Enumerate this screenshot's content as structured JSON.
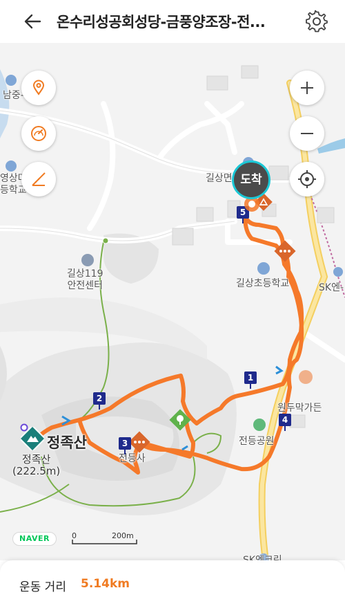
{
  "header": {
    "title": "온수리성공회성당-금풍양조장-전..."
  },
  "map": {
    "labels": {
      "school_top": "길상초등학교",
      "school_partial_top": "남중-",
      "school_left": "영상마\n등학교",
      "fire_station": "길상119\n안전센터",
      "gilsang_top": "길상면",
      "gilsang_school": "길상초등학교",
      "sk": "SK엔-",
      "peak_name": "정족산",
      "peak_label": "정족산\n(222.5m)",
      "temple": "전등사",
      "park": "전등공원",
      "restaurant": "원두막가든",
      "bottom_station": "SK엔크린"
    },
    "arrival_label": "도착",
    "waypoints": [
      "1",
      "2",
      "3",
      "4",
      "5"
    ],
    "route_color": "#f5792a",
    "scale": {
      "zero": "0",
      "distance": "200m"
    },
    "brand": "NAVER"
  },
  "controls": {
    "left": [
      "location-pin-icon",
      "speedometer-icon",
      "elevation-icon"
    ],
    "right": [
      "zoom-in-icon",
      "zoom-out-icon",
      "crosshair-icon"
    ]
  },
  "stats": {
    "distance_label": "운동 거리",
    "distance_value": "5.14km"
  }
}
